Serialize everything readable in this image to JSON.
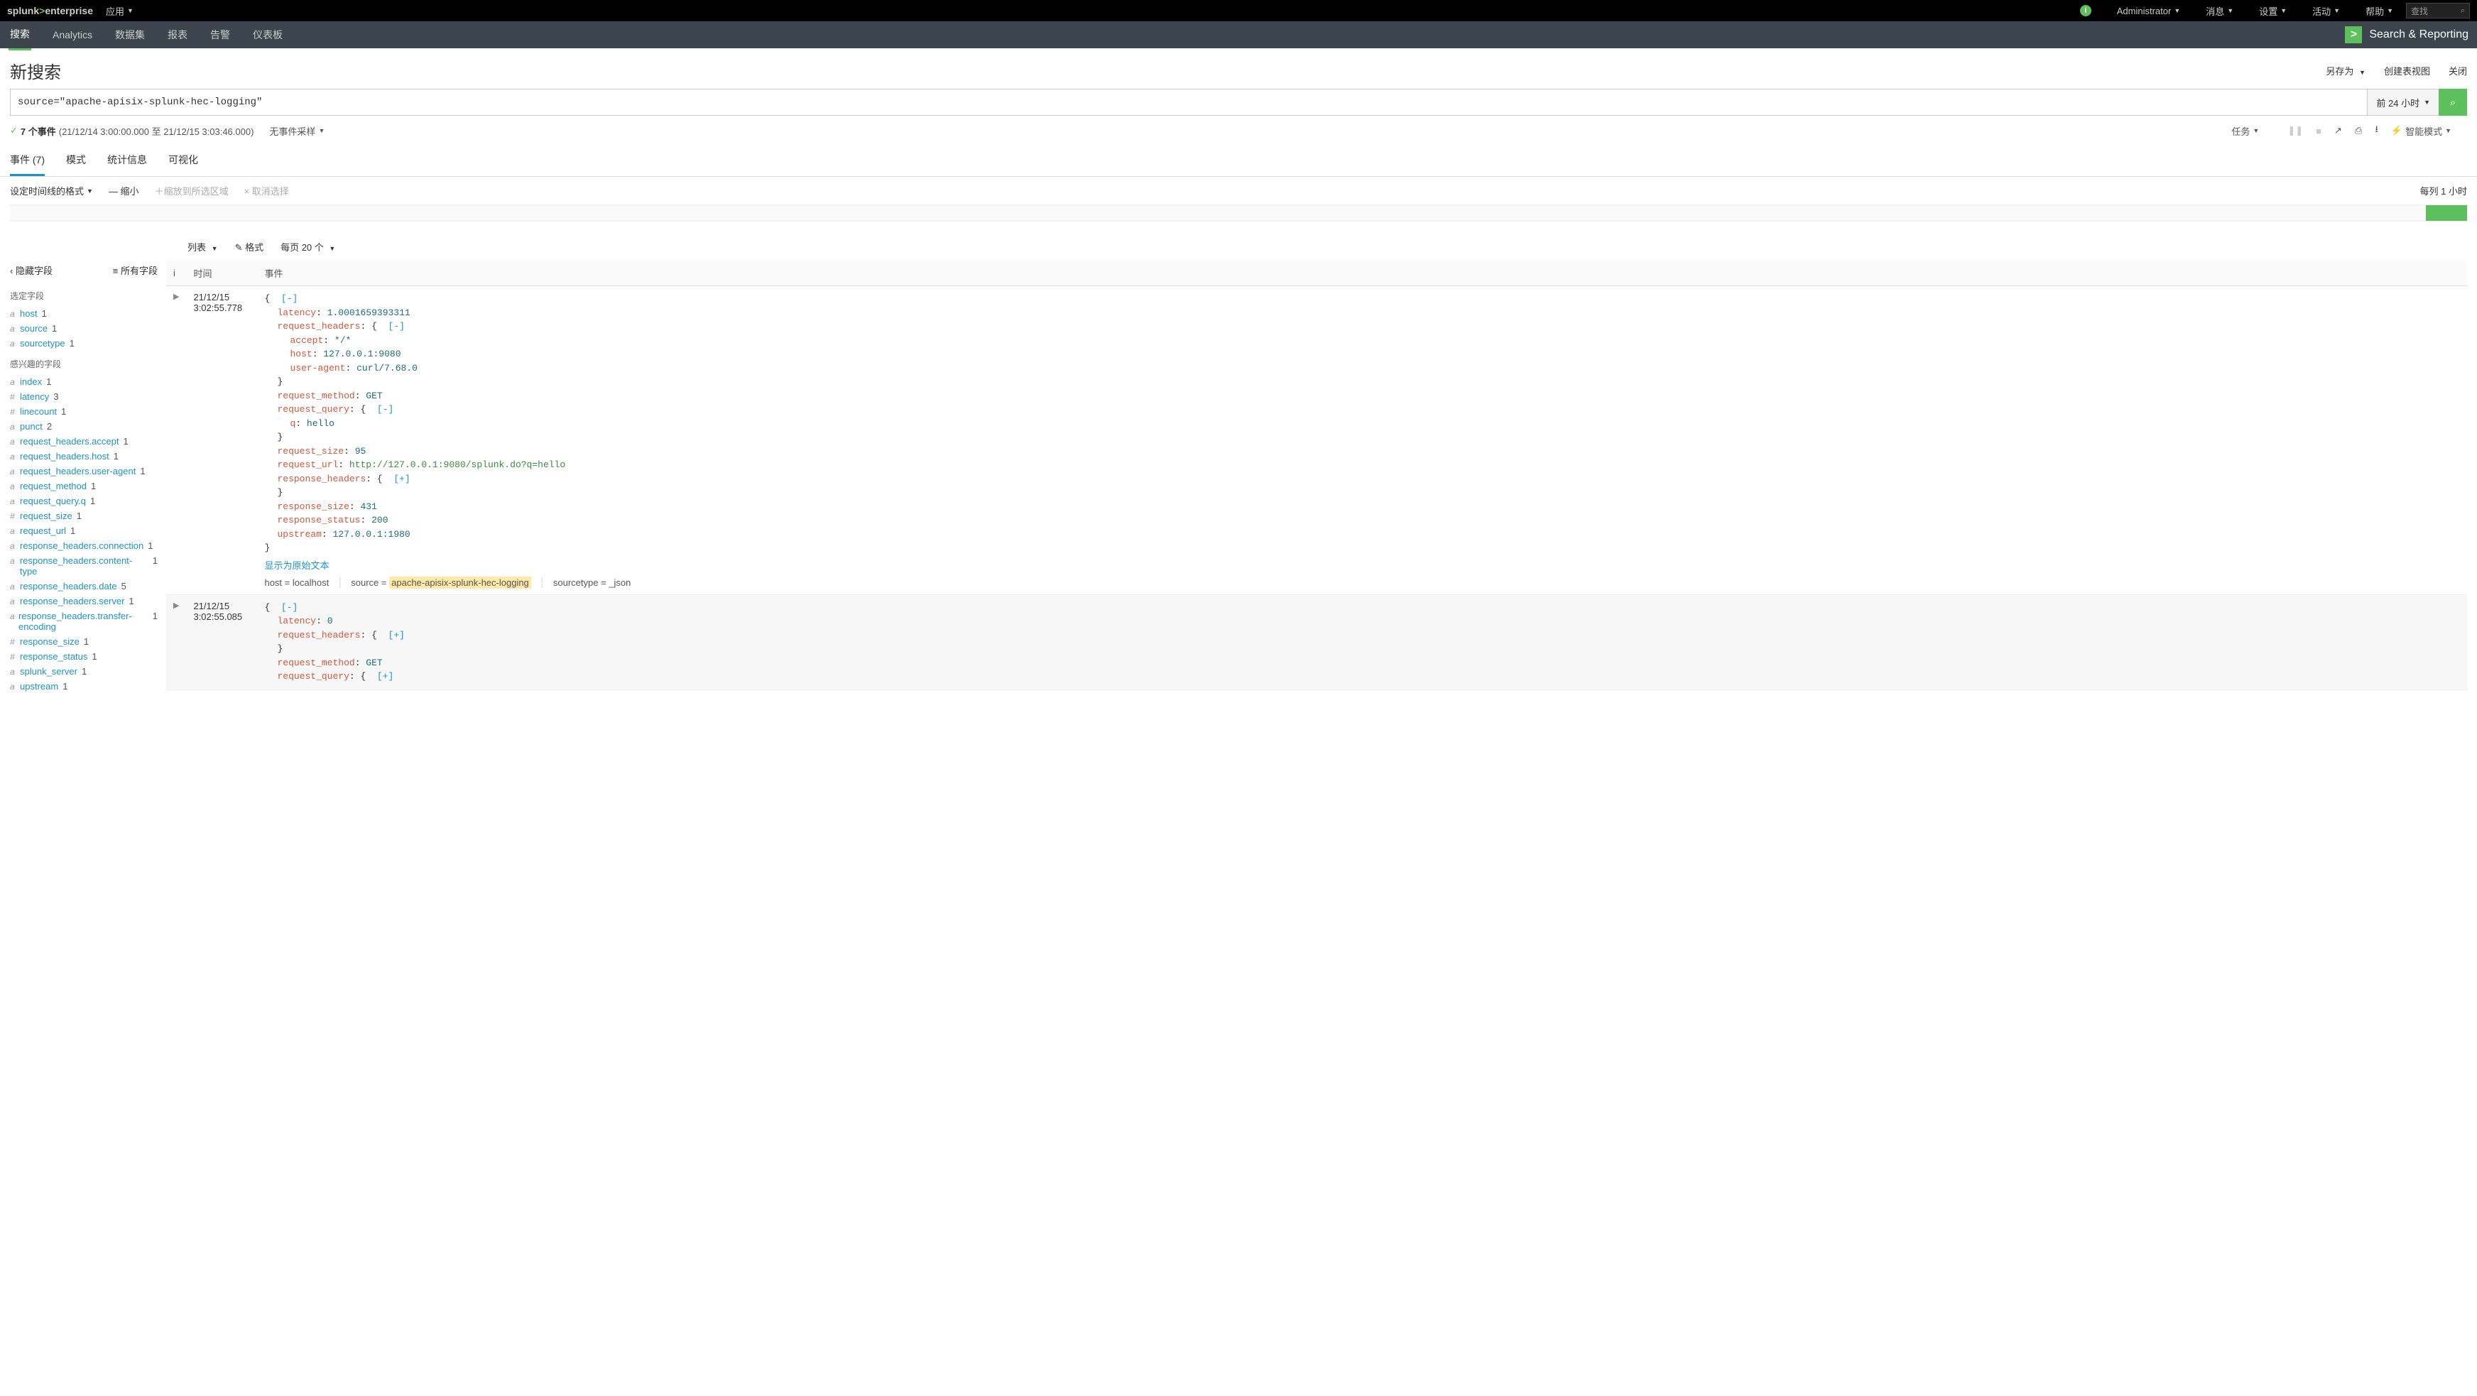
{
  "top": {
    "logo_a": "splunk",
    "logo_b": ">",
    "logo_c": "enterprise",
    "app": "应用",
    "admin": "Administrator",
    "msgs": "消息",
    "settings": "设置",
    "activity": "活动",
    "help": "帮助",
    "find": "查找"
  },
  "nav": {
    "search": "搜索",
    "analytics": "Analytics",
    "datasets": "数据集",
    "reports": "报表",
    "alerts": "告警",
    "dashboards": "仪表板",
    "brand": "Search & Reporting"
  },
  "page": {
    "title": "新搜索",
    "saveas": "另存为",
    "createview": "创建表视图",
    "close": "关闭"
  },
  "search": {
    "query": "source=\"apache-apisix-splunk-hec-logging\"",
    "timerange": "前 24 小时"
  },
  "status": {
    "count": "7 个事件",
    "range": "(21/12/14 3:00:00.000 至 21/12/15 3:03:46.000)",
    "sampling": "无事件采样",
    "jobs": "任务",
    "mode": "智能模式"
  },
  "tabs": {
    "events": "事件 (7)",
    "patterns": "模式",
    "stats": "统计信息",
    "viz": "可视化"
  },
  "timeline": {
    "format": "设定时间线的格式",
    "zoomout": "— 缩小",
    "zoomin": "＋缩放到所选区域",
    "deselect": "× 取消选择",
    "scale": "每列 1 小时"
  },
  "rtoolbar": {
    "list": "列表",
    "format": "格式",
    "perpage": "每页 20 个"
  },
  "sidebar": {
    "hide": "隐藏字段",
    "all": "所有字段",
    "selected": "选定字段",
    "interesting": "感兴趣的字段",
    "fields_sel": [
      {
        "t": "a",
        "n": "host",
        "c": "1"
      },
      {
        "t": "a",
        "n": "source",
        "c": "1"
      },
      {
        "t": "a",
        "n": "sourcetype",
        "c": "1"
      }
    ],
    "fields_int": [
      {
        "t": "a",
        "n": "index",
        "c": "1"
      },
      {
        "t": "#",
        "n": "latency",
        "c": "3"
      },
      {
        "t": "#",
        "n": "linecount",
        "c": "1"
      },
      {
        "t": "a",
        "n": "punct",
        "c": "2"
      },
      {
        "t": "a",
        "n": "request_headers.accept",
        "c": "1"
      },
      {
        "t": "a",
        "n": "request_headers.host",
        "c": "1"
      },
      {
        "t": "a",
        "n": "request_headers.user-agent",
        "c": "1"
      },
      {
        "t": "a",
        "n": "request_method",
        "c": "1"
      },
      {
        "t": "a",
        "n": "request_query.q",
        "c": "1"
      },
      {
        "t": "#",
        "n": "request_size",
        "c": "1"
      },
      {
        "t": "a",
        "n": "request_url",
        "c": "1"
      },
      {
        "t": "a",
        "n": "response_headers.connection",
        "c": "1"
      },
      {
        "t": "a",
        "n": "response_headers.content-type",
        "c": "1"
      },
      {
        "t": "a",
        "n": "response_headers.date",
        "c": "5"
      },
      {
        "t": "a",
        "n": "response_headers.server",
        "c": "1"
      },
      {
        "t": "a",
        "n": "response_headers.transfer-encoding",
        "c": "1"
      },
      {
        "t": "#",
        "n": "response_size",
        "c": "1"
      },
      {
        "t": "#",
        "n": "response_status",
        "c": "1"
      },
      {
        "t": "a",
        "n": "splunk_server",
        "c": "1"
      },
      {
        "t": "a",
        "n": "upstream",
        "c": "1"
      }
    ]
  },
  "cols": {
    "i": "i",
    "time": "时间",
    "event": "事件"
  },
  "events": [
    {
      "date": "21/12/15",
      "time": "3:02:55.778",
      "json": {
        "latency": "1.0001659393311",
        "accept": "*/*",
        "host": "127.0.0.1:9080",
        "ua": "curl/7.68.0",
        "method": "GET",
        "q": "hello",
        "req_size": "95",
        "url": "http://127.0.0.1:9080/splunk.do?q=hello",
        "resp_size": "431",
        "status": "200",
        "upstream": "127.0.0.1:1980"
      },
      "raw": "显示为原始文本",
      "meta": {
        "host_k": "host =",
        "host_v": "localhost",
        "src_k": "source =",
        "src_v": "apache-apisix-splunk-hec-logging",
        "st_k": "sourcetype =",
        "st_v": "_json"
      }
    },
    {
      "date": "21/12/15",
      "time": "3:02:55.085",
      "json": {
        "latency": "0",
        "method": "GET"
      }
    }
  ],
  "jkeys": {
    "latency": "latency",
    "req_hdr": "request_headers",
    "accept": "accept",
    "host": "host",
    "ua": "user-agent",
    "method": "request_method",
    "query": "request_query",
    "q": "q",
    "req_size": "request_size",
    "url": "request_url",
    "resp_hdr": "response_headers",
    "resp_size": "response_size",
    "status": "response_status",
    "upstream": "upstream"
  },
  "collapse": {
    "minus": "[-]",
    "plus": "[+]"
  }
}
